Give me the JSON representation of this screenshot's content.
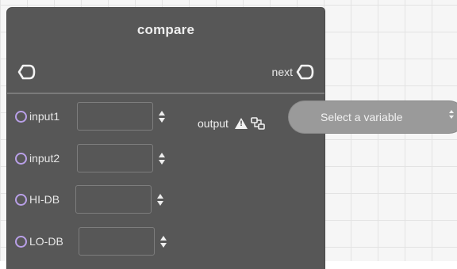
{
  "node": {
    "title": "compare",
    "exec_out_label": "next",
    "inputs": [
      {
        "label": "input1",
        "value": ""
      },
      {
        "label": "input2",
        "value": ""
      },
      {
        "label": "HI-DB",
        "value": ""
      },
      {
        "label": "LO-DB",
        "value": ""
      }
    ],
    "output": {
      "label": "output",
      "warning_icon": "warning-icon",
      "link_icon": "variable-link-icon",
      "select_placeholder": "Select a variable"
    }
  },
  "colors": {
    "node_bg": "#575757",
    "pin_border": "#b9a0e8",
    "select_bg": "#9a9a9a",
    "canvas_bg": "#f6f6f6"
  }
}
